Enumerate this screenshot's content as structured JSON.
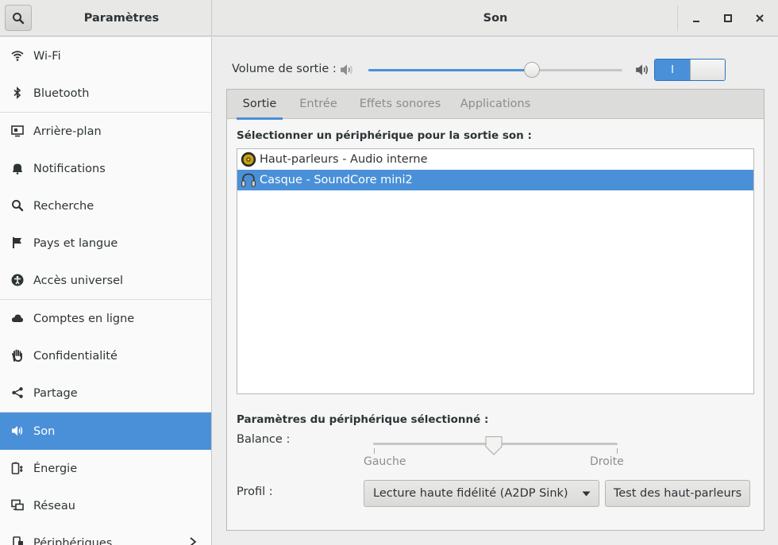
{
  "header": {
    "sidebar_title": "Paramètres",
    "panel_title": "Son",
    "search_icon": "search-icon",
    "window_buttons": [
      "minimize-icon",
      "maximize-icon",
      "close-icon"
    ]
  },
  "sidebar": {
    "items": [
      {
        "label": "Wi-Fi",
        "icon": "wifi-icon"
      },
      {
        "label": "Bluetooth",
        "icon": "bluetooth-icon"
      },
      {
        "label": "Arrière-plan",
        "icon": "background-icon"
      },
      {
        "label": "Notifications",
        "icon": "bell-icon"
      },
      {
        "label": "Recherche",
        "icon": "search-icon"
      },
      {
        "label": "Pays et langue",
        "icon": "flag-icon"
      },
      {
        "label": "Accès universel",
        "icon": "accessibility-icon"
      },
      {
        "label": "Comptes en ligne",
        "icon": "cloud-icon"
      },
      {
        "label": "Confidentialité",
        "icon": "hand-icon"
      },
      {
        "label": "Partage",
        "icon": "share-icon"
      },
      {
        "label": "Son",
        "icon": "speaker-icon",
        "active": true
      },
      {
        "label": "Énergie",
        "icon": "power-icon"
      },
      {
        "label": "Réseau",
        "icon": "network-icon"
      },
      {
        "label": "Périphériques",
        "icon": "devices-icon"
      }
    ],
    "accent": "#4a90d9"
  },
  "volume": {
    "label": "Volume de sortie :",
    "level_fraction": 0.645,
    "switch_on_label": "I",
    "switch_state": "on"
  },
  "tabs": [
    {
      "label": "Sortie",
      "active": true
    },
    {
      "label": "Entrée"
    },
    {
      "label": "Effets sonores"
    },
    {
      "label": "Applications"
    }
  ],
  "output": {
    "select_title": "Sélectionner un périphérique pour la sortie son :",
    "devices": [
      {
        "label": "Haut-parleurs - Audio interne",
        "icon": "speaker-device-icon"
      },
      {
        "label": "Casque - SoundCore mini2",
        "icon": "headphones-icon",
        "selected": true
      }
    ],
    "settings_title": "Paramètres du périphérique sélectionné :",
    "balance_label": "Balance :",
    "balance_left": "Gauche",
    "balance_right": "Droite",
    "balance_value": 0.5,
    "profile_label": "Profil :",
    "profile_value": "Lecture haute fidélité (A2DP Sink)",
    "test_button": "Test des haut-parleurs"
  }
}
